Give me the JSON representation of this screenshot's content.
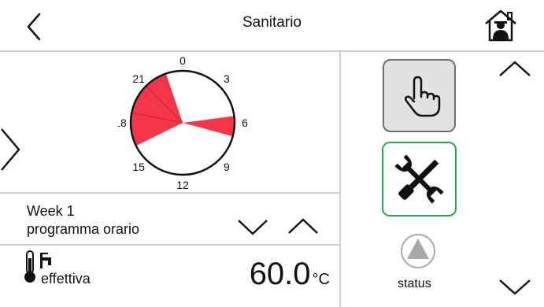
{
  "header": {
    "title": "Sanitario"
  },
  "clock": {
    "hour_labels": [
      "0",
      "3",
      "6",
      "9",
      "12",
      "15",
      "18",
      "21"
    ],
    "active_color": "#f5364a",
    "active_periods": [
      {
        "start": 5.5,
        "end": 7.0
      },
      {
        "start": 16.25,
        "end": 22.75
      }
    ]
  },
  "schedule": {
    "week": "Week 1",
    "subtitle": "programma orario"
  },
  "temperature": {
    "label": "effettiva",
    "value": "60.0",
    "unit": "°C"
  },
  "status": {
    "label": "status"
  },
  "colors": {
    "divider": "#cfcfcf",
    "tools_border": "#2aa84a",
    "hand_bg": "#e2e2e2"
  },
  "icons": [
    "back-chevron-icon",
    "home-icon",
    "left-arrow-icon",
    "hand-icon",
    "tools-icon",
    "scroll-up-icon",
    "scroll-down-icon",
    "thermometer-icon",
    "tap-icon",
    "status-indicator-icon"
  ]
}
